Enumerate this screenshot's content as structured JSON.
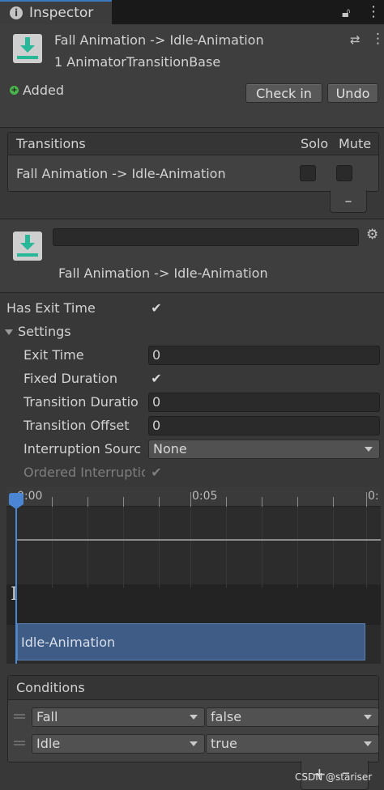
{
  "tab": {
    "title": "Inspector",
    "info_icon": "i"
  },
  "header": {
    "title": "Fall Animation -> Idle-Animation",
    "subtitle": "1 AnimatorTransitionBase",
    "added_label": "Added",
    "check_in_label": "Check in",
    "undo_label": "Undo"
  },
  "transitions": {
    "header_label": "Transitions",
    "solo_label": "Solo",
    "mute_label": "Mute",
    "rows": [
      {
        "name": "Fall Animation -> Idle-Animation",
        "solo": false,
        "mute": false
      }
    ],
    "remove_label": "–"
  },
  "transition_header": {
    "name_value": "",
    "title": "Fall Animation -> Idle-Animation"
  },
  "properties": {
    "has_exit_time": {
      "label": "Has Exit Time",
      "checked": true
    },
    "settings_label": "Settings",
    "exit_time": {
      "label": "Exit Time",
      "value": "0"
    },
    "fixed_duration": {
      "label": "Fixed Duration",
      "checked": true
    },
    "transition_duration": {
      "label": "Transition Duratio",
      "value": "0"
    },
    "transition_offset": {
      "label": "Transition Offset",
      "value": "0"
    },
    "interruption_source": {
      "label": "Interruption Sourc",
      "value": "None"
    },
    "ordered_interruption": {
      "label": "Ordered Interruptio",
      "checked": true
    }
  },
  "timeline": {
    "tick_labels": [
      "0:00",
      "0:05",
      "0:"
    ],
    "clip_name": "Idle-Animation"
  },
  "conditions": {
    "header_label": "Conditions",
    "rows": [
      {
        "parameter": "Fall",
        "value": "false"
      },
      {
        "parameter": "Idle",
        "value": "true"
      }
    ],
    "add_label": "+",
    "remove_label": "–"
  },
  "watermark": "CSDN @stariser",
  "colors": {
    "accent_blue": "#4a86d4",
    "clip_blue": "#3f5c87",
    "added_green": "#4ab54a",
    "icon_teal": "#27b89a"
  }
}
